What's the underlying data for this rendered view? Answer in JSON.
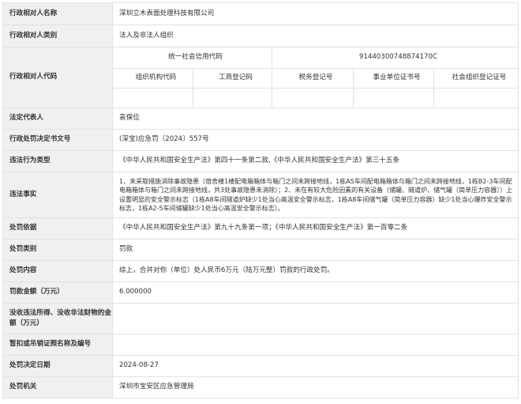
{
  "rows": {
    "name": {
      "label": "行政相对人名称",
      "value": "深圳立木表面处理科技有限公司"
    },
    "category": {
      "label": "行政相对人类别",
      "value": "法人及非法人组织"
    },
    "code": {
      "label": "行政相对人代码",
      "credit_code_label": "统一社会信用代码",
      "credit_code_value": "91440300748874170C",
      "headers": [
        "组织机构代码",
        "工商登记码",
        "税务登记号",
        "事业单位证书号",
        "社会组织登记证号"
      ]
    },
    "legal_rep": {
      "label": "法定代表人",
      "value": "袁保位"
    },
    "doc_no": {
      "label": "行政处罚决定书文号",
      "value": "(深宝)应急罚〔2024〕557号"
    },
    "violation_type": {
      "label": "违法行为类型",
      "value": "《中华人民共和国安全生产法》第四十一条第二款,《中华人民共和国安全生产法》第三十五条"
    },
    "facts": {
      "label": "违法事实",
      "value": "1、未采取措施消除事故隐患（宿舍楼1楼配电箱箱体与箱门之间未跨接地线，1栋A5车间配电箱箱体与箱门之间未跨接地线，1栋B2-3车间配电箱箱体与箱门之间未跨接地线，共3处事故隐患未消除）；2、未在有较大危险因素的有关设备（储罐、隧道炉、储气罐（简单压力容器））上设置明显的安全警示标志（1栋A8车间隧道炉缺少1处当心高温安全警示标志，1栋A8车间储气罐（简单压力容器）缺少1处当心爆炸安全警示标志，1栋A2-5车间储罐缺少1处当心高温安全警示标志）。"
    },
    "basis": {
      "label": "处罚依据",
      "value": "《中华人民共和国安全生产法》第九十九条第一项；《中华人民共和国安全生产法》第一百零二条"
    },
    "penalty_type": {
      "label": "处罚类别",
      "value": "罚款"
    },
    "content": {
      "label": "处罚内容",
      "value": "综上，合并对你（单位）处人民币6万元（陆万元整）罚款的行政处罚。"
    },
    "amount": {
      "label": "罚款金额（万元）",
      "value": "6.000000"
    },
    "confiscation": {
      "label": "没收违法所得、没收非法财物的金额（万元）",
      "value": ""
    },
    "license": {
      "label": "暂扣或吊销证照名称及编号",
      "value": ""
    },
    "date": {
      "label": "处罚决定日期",
      "value": "2024-08-27"
    },
    "authority": {
      "label": "处罚机关",
      "value": "深圳市宝安区应急管理局"
    }
  }
}
